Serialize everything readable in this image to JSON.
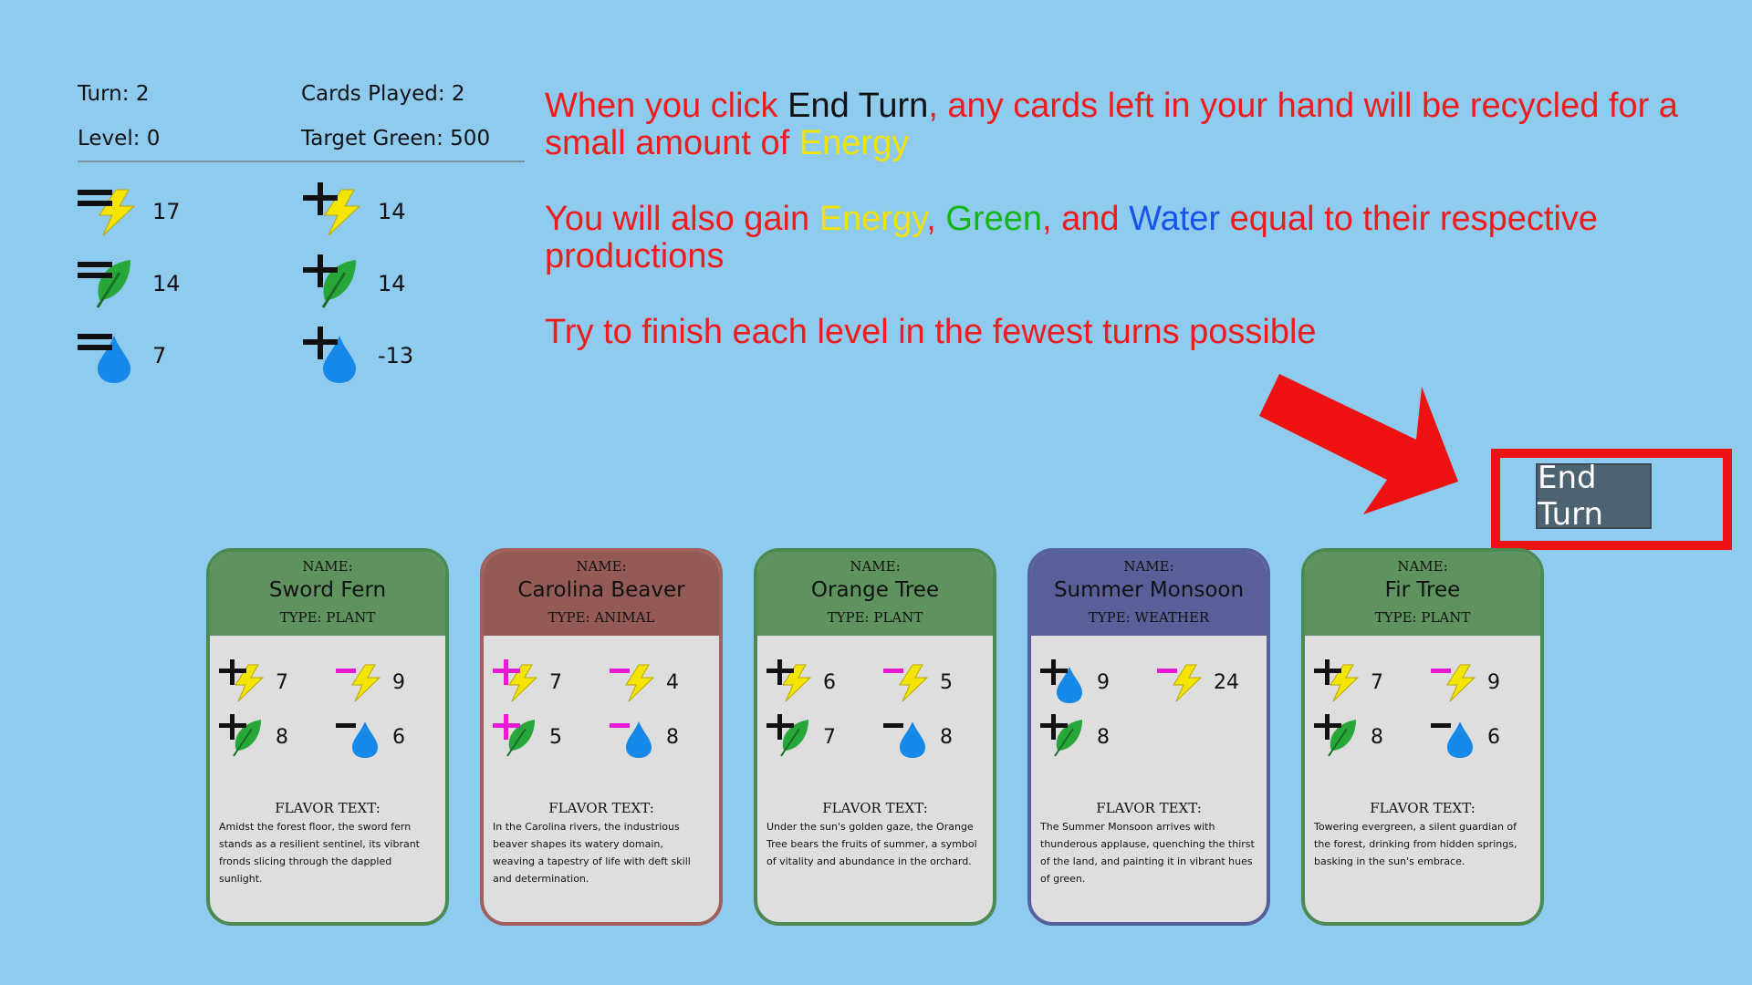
{
  "status": {
    "turn": "Turn: 2",
    "cards_played": "Cards Played: 2",
    "level": "Level: 0",
    "target_green": "Target Green: 500"
  },
  "resources": {
    "energy_total": "17",
    "energy_prod": "14",
    "green_total": "14",
    "green_prod": "14",
    "water_total": "7",
    "water_prod": "-13"
  },
  "message": {
    "l1a": "When you click ",
    "l1b": "End Turn",
    "l1c": ", any cards left in your hand will be recycled for a small amount of ",
    "l1d": "Energy",
    "l2a": "You will also gain ",
    "l2b": "Energy",
    "l2c": ", ",
    "l2d": "Green",
    "l2e": ", and ",
    "l2f": "Water",
    "l2g": " equal to their respective productions",
    "l3": "Try to finish each level in the fewest turns possible"
  },
  "end_turn_label": "End Turn",
  "colors": {
    "energy": "#f5e400",
    "green": "#27a63a",
    "water": "#1588e8",
    "magenta": "#e81ad2",
    "plant": "#5e9360",
    "animal": "#945a56",
    "weather": "#5a5f99"
  },
  "cards": [
    {
      "name_label": "NAME:",
      "name": "Sword Fern",
      "type": "TYPE: PLANT",
      "s1": "7",
      "s2": "9",
      "s3": "8",
      "s4": "6",
      "flavor_label": "FLAVOR TEXT:",
      "flavor": "Amidst the forest floor, the sword fern stands as a resilient sentinel, its vibrant fronds slicing through the dappled sunlight."
    },
    {
      "name_label": "NAME:",
      "name": "Carolina Beaver",
      "type": "TYPE: ANIMAL",
      "s1": "7",
      "s2": "4",
      "s3": "5",
      "s4": "8",
      "flavor_label": "FLAVOR TEXT:",
      "flavor": "In the Carolina rivers, the industrious beaver shapes its watery domain, weaving a tapestry of life with deft skill and determination."
    },
    {
      "name_label": "NAME:",
      "name": "Orange Tree",
      "type": "TYPE: PLANT",
      "s1": "6",
      "s2": "5",
      "s3": "7",
      "s4": "8",
      "flavor_label": "FLAVOR TEXT:",
      "flavor": "Under the sun's golden gaze, the Orange Tree bears the fruits of summer, a symbol of vitality and abundance in the orchard."
    },
    {
      "name_label": "NAME:",
      "name": "Summer Monsoon",
      "type": "TYPE: WEATHER",
      "s1": "9",
      "s2": "24",
      "s3": "8",
      "s4": "",
      "flavor_label": "FLAVOR TEXT:",
      "flavor": "The Summer Monsoon arrives with thunderous applause, quenching the thirst of the land, and painting it in vibrant hues of green."
    },
    {
      "name_label": "NAME:",
      "name": "Fir Tree",
      "type": "TYPE: PLANT",
      "s1": "7",
      "s2": "9",
      "s3": "8",
      "s4": "6",
      "flavor_label": "FLAVOR TEXT:",
      "flavor": "Towering evergreen, a silent guardian of the forest, drinking from hidden springs, basking in the sun's embrace."
    }
  ]
}
